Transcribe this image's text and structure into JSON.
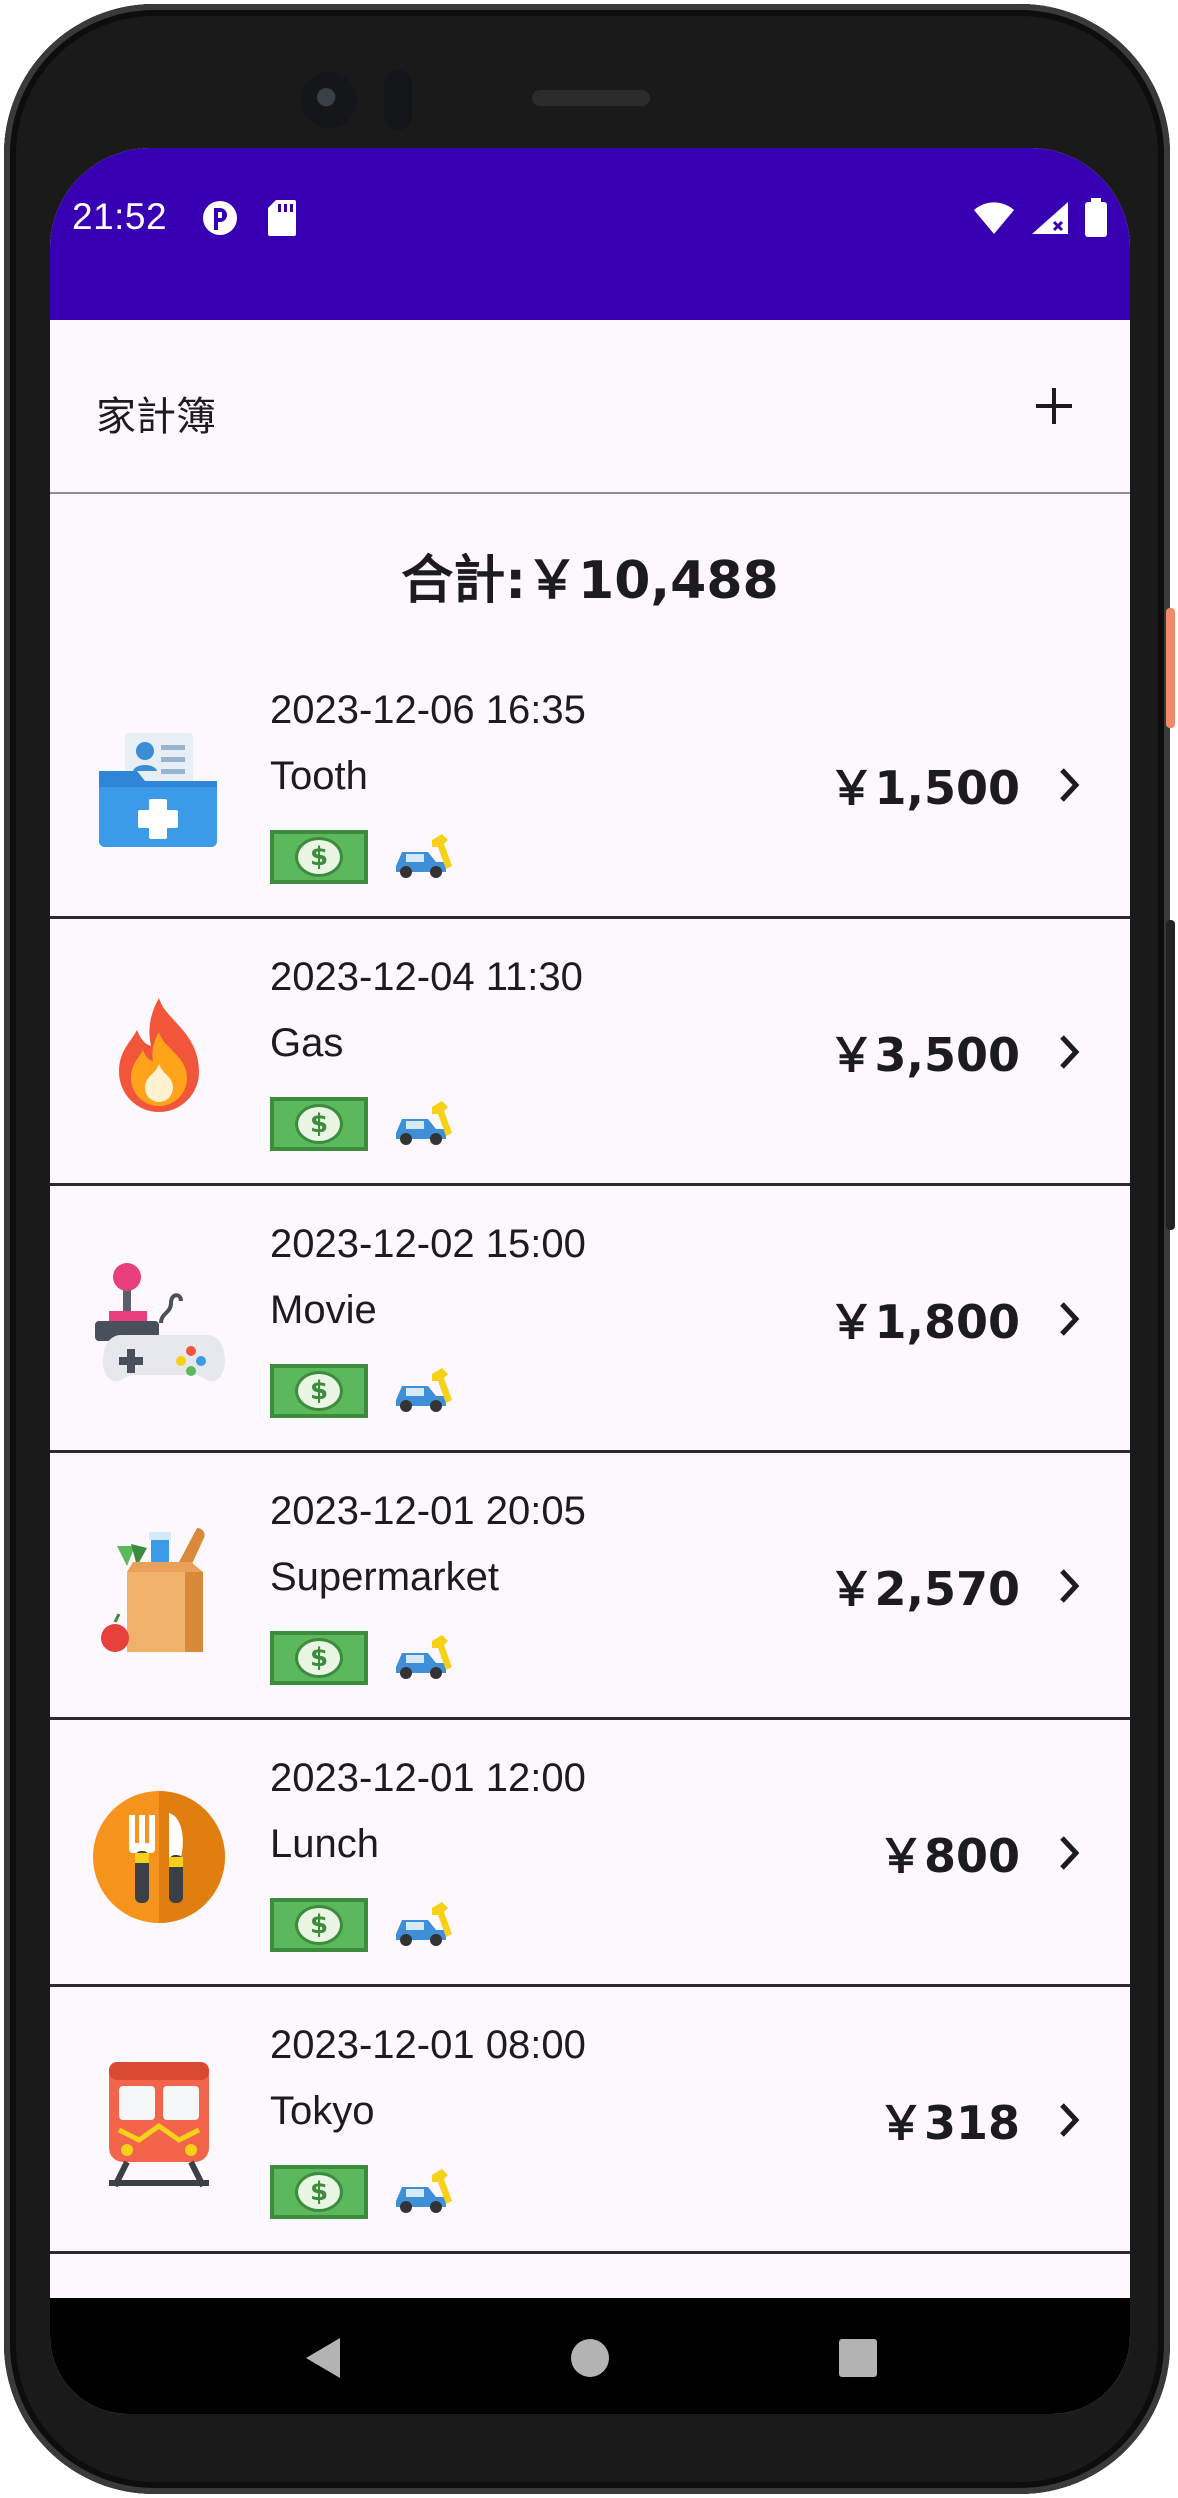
{
  "status_bar": {
    "time": "21:52",
    "left_icons": [
      "data-saver-icon",
      "sd-card-icon"
    ],
    "right_icons": [
      "wifi-icon",
      "signal-icon",
      "battery-icon"
    ],
    "background": "#3700b3"
  },
  "app_bar": {
    "title": "家計簿",
    "action_icon": "plus-icon"
  },
  "summary": {
    "total": "合計:￥10,488"
  },
  "transactions": [
    {
      "date": "2023-12-06 16:35",
      "name": "Tooth",
      "amount": "￥1,500",
      "icon": "medical-folder-icon",
      "badges": [
        "cash-icon",
        "car-repair-icon"
      ]
    },
    {
      "date": "2023-12-04 11:30",
      "name": "Gas",
      "amount": "￥3,500",
      "icon": "flame-icon",
      "badges": [
        "cash-icon",
        "car-repair-icon"
      ]
    },
    {
      "date": "2023-12-02 15:00",
      "name": "Movie",
      "amount": "￥1,800",
      "icon": "game-controller-icon",
      "badges": [
        "cash-icon",
        "car-repair-icon"
      ]
    },
    {
      "date": "2023-12-01 20:05",
      "name": "Supermarket",
      "amount": "￥2,570",
      "icon": "grocery-bag-icon",
      "badges": [
        "cash-icon",
        "car-repair-icon"
      ]
    },
    {
      "date": "2023-12-01 12:00",
      "name": "Lunch",
      "amount": "￥800",
      "icon": "fork-knife-icon",
      "badges": [
        "cash-icon",
        "car-repair-icon"
      ]
    },
    {
      "date": "2023-12-01 08:00",
      "name": "Tokyo",
      "amount": "￥318",
      "icon": "train-icon",
      "badges": [
        "cash-icon",
        "car-repair-icon"
      ]
    }
  ],
  "nav_bar": {
    "buttons": [
      "back-icon",
      "home-icon",
      "recents-icon"
    ]
  }
}
